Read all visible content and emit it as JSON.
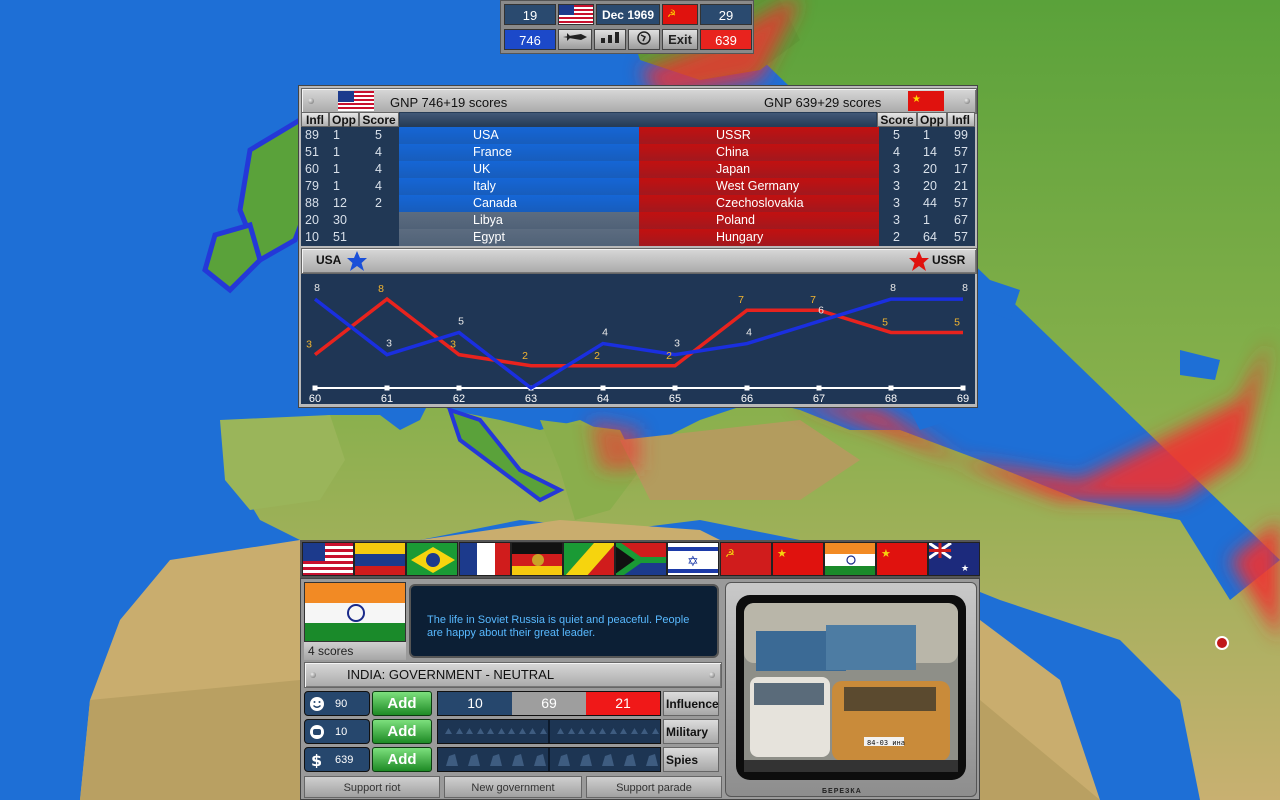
{
  "topbar": {
    "usa_count": "19",
    "date": "Dec 1969",
    "ussr_count": "29",
    "usa_gnp": "746",
    "ussr_gnp": "639",
    "exit_label": "Exit",
    "icons": [
      "missile-icon",
      "bars-icon",
      "globe-icon"
    ],
    "usa_color": "#1c49c9",
    "ussr_color": "#e8231e"
  },
  "score": {
    "usa_gnp_text": "GNP 746+19 scores",
    "ussr_gnp_text": "GNP 639+29 scores",
    "headers_left": [
      "Infl",
      "Opp",
      "Score"
    ],
    "headers_right": [
      "Score",
      "Opp",
      "Infl"
    ],
    "rows": [
      {
        "l_infl": "89",
        "l_opp": "1",
        "l_score": "5",
        "l_name": "USA",
        "r_name": "USSR",
        "r_score": "5",
        "r_opp": "1",
        "r_infl": "99",
        "l_fill": "#1566d6",
        "r_fill": "#c21010"
      },
      {
        "l_infl": "51",
        "l_opp": "1",
        "l_score": "4",
        "l_name": "France",
        "r_name": "China",
        "r_score": "4",
        "r_opp": "14",
        "r_infl": "57",
        "l_fill": "#1566d6",
        "r_fill": "#c21010"
      },
      {
        "l_infl": "60",
        "l_opp": "1",
        "l_score": "4",
        "l_name": "UK",
        "r_name": "Japan",
        "r_score": "3",
        "r_opp": "20",
        "r_infl": "17",
        "l_fill": "#1566d6",
        "r_fill": "#c21010"
      },
      {
        "l_infl": "79",
        "l_opp": "1",
        "l_score": "4",
        "l_name": "Italy",
        "r_name": "West Germany",
        "r_score": "3",
        "r_opp": "20",
        "r_infl": "21",
        "l_fill": "#1566d6",
        "r_fill": "#c21010"
      },
      {
        "l_infl": "88",
        "l_opp": "12",
        "l_score": "2",
        "l_name": "Canada",
        "r_name": "Czechoslovakia",
        "r_score": "3",
        "r_opp": "44",
        "r_infl": "57",
        "l_fill": "#1566d6",
        "r_fill": "#c21010"
      },
      {
        "l_infl": "20",
        "l_opp": "30",
        "l_score": "",
        "l_name": "Libya",
        "r_name": "Poland",
        "r_score": "3",
        "r_opp": "1",
        "r_infl": "67",
        "l_fill": "#5c6c80",
        "r_fill": "#c21010"
      },
      {
        "l_infl": "10",
        "l_opp": "51",
        "l_score": "",
        "l_name": "Egypt",
        "r_name": "Hungary",
        "r_score": "2",
        "r_opp": "64",
        "r_infl": "57",
        "l_fill": "#5c6c80",
        "r_fill": "#c21010"
      }
    ],
    "usa_label": "USA",
    "ussr_label": "USSR"
  },
  "chart_data": {
    "type": "line",
    "x": [
      "60",
      "61",
      "62",
      "63",
      "64",
      "65",
      "66",
      "67",
      "68",
      "69"
    ],
    "ylim": [
      0,
      9
    ],
    "series": [
      {
        "name": "USA",
        "color": "#1a2fe0",
        "values": [
          8,
          3,
          5,
          0,
          4,
          3,
          4,
          6,
          8,
          8
        ],
        "labels": [
          "8",
          "3",
          "5",
          "",
          "4",
          "3",
          "4",
          "6",
          "8",
          "8"
        ]
      },
      {
        "name": "USSR",
        "color": "#e8231e",
        "values": [
          3,
          8,
          3,
          2,
          2,
          2,
          7,
          7,
          5,
          5
        ],
        "labels": [
          "3",
          "8",
          "3",
          "2",
          "2",
          "2",
          "7",
          "7",
          "5",
          "5"
        ]
      }
    ]
  },
  "flags": [
    "USA",
    "Venezuela",
    "Brazil",
    "France",
    "East Germany",
    "Congo",
    "South Africa",
    "Israel",
    "USSR",
    "China",
    "India",
    "China",
    "Australia"
  ],
  "country": {
    "score_text": "4 scores",
    "government_text": "INDIA: GOVERNMENT - NEUTRAL",
    "message": "The life in Soviet Russia is quiet and peaceful. People are happy about their great leader.",
    "stats": [
      {
        "icon": "smile-icon",
        "value": "90",
        "add": "Add",
        "left": "10",
        "mid": "69",
        "right": "21",
        "label": "Influence"
      },
      {
        "icon": "fist-icon",
        "value": "10",
        "add": "Add",
        "label": "Military"
      },
      {
        "icon": "dollar-icon",
        "value": "639",
        "add": "Add",
        "label": "Spies"
      }
    ],
    "actions": [
      "Support riot",
      "New government",
      "Support parade"
    ],
    "tv_brand": "БЕРЕЗКА",
    "plate": "84-03 ина"
  }
}
